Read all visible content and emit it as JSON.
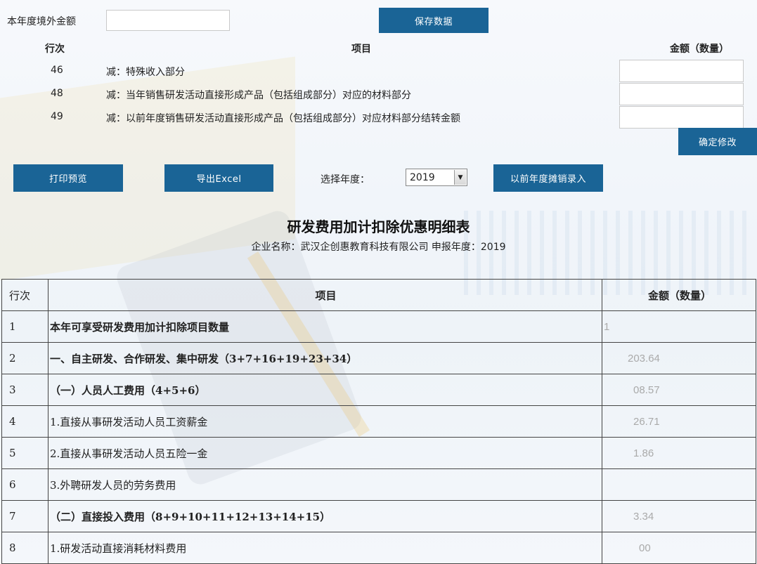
{
  "top_form": {
    "overseas_label": "本年度境外金额",
    "overseas_value": "",
    "save_label": "保存数据"
  },
  "mini_table": {
    "headers": {
      "row": "行次",
      "item": "项目",
      "amount": "金额（数量）"
    },
    "rows": [
      {
        "no": "46",
        "item": "减：特殊收入部分",
        "value": ""
      },
      {
        "no": "48",
        "item": "减：当年销售研发活动直接形成产品（包括组成部分）对应的材料部分",
        "value": ""
      },
      {
        "no": "49",
        "item": "减：以前年度销售研发活动直接形成产品（包括组成部分）对应材料部分结转金额",
        "value": ""
      }
    ],
    "confirm_label": "确定修改"
  },
  "toolbar": {
    "print_label": "打印预览",
    "export_label": "导出Excel",
    "year_label": "选择年度：",
    "year_value": "2019",
    "prior_label": "以前年度摊销录入"
  },
  "report": {
    "title": "研发费用加计扣除优惠明细表",
    "subtitle": "企业名称：武汉企创惠教育科技有限公司 申报年度：2019",
    "headers": {
      "row": "行次",
      "item": "项目",
      "amount": "金额（数量）"
    },
    "rows": [
      {
        "no": "1",
        "item": "本年可享受研发费用加计扣除项目数量",
        "amount": "1",
        "bold": true
      },
      {
        "no": "2",
        "item": "一、自主研发、合作研发、集中研发（3+7+16+19+23+34）",
        "amount": "203.64",
        "bold": true
      },
      {
        "no": "3",
        "item": "（一）人员人工费用（4+5+6）",
        "amount": "08.57",
        "bold": true
      },
      {
        "no": "4",
        "item": "1.直接从事研发活动人员工资薪金",
        "amount": "26.71",
        "bold": false
      },
      {
        "no": "5",
        "item": "2.直接从事研发活动人员五险一金",
        "amount": "1.86",
        "bold": false
      },
      {
        "no": "6",
        "item": "3.外聘研发人员的劳务费用",
        "amount": "",
        "bold": false
      },
      {
        "no": "7",
        "item": "（二）直接投入费用（8+9+10+11+12+13+14+15）",
        "amount": "3.34",
        "bold": true
      },
      {
        "no": "8",
        "item": "1.研发活动直接消耗材料费用",
        "amount": "00",
        "bold": false
      }
    ]
  },
  "colors": {
    "button": "#1a6496",
    "button_text": "#ffffff"
  }
}
